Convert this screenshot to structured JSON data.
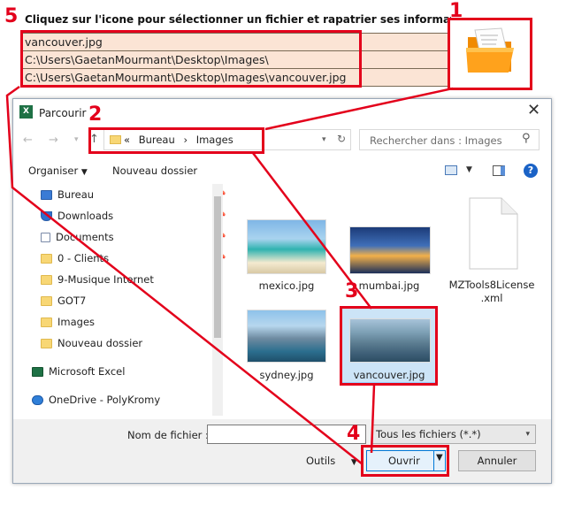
{
  "sheet": {
    "instruction": "Cliquez sur l'icone pour sélectionner un fichier et rapatrier ses informations",
    "rows": [
      "vancouver.jpg",
      "C:\\Users\\GaetanMourmant\\Desktop\\Images\\",
      "C:\\Users\\GaetanMourmant\\Desktop\\Images\\vancouver.jpg"
    ]
  },
  "annotations": {
    "n1": "1",
    "n2": "2",
    "n3": "3",
    "n4": "4",
    "n5": "5",
    "color": "#e3001b"
  },
  "dialog": {
    "title": "Parcourir",
    "app_icon": "X",
    "address": {
      "prefix": "«",
      "parts": [
        "Bureau",
        "Images"
      ],
      "separator": "›"
    },
    "search_placeholder": "Rechercher dans : Images",
    "toolbar": {
      "organize": "Organiser",
      "new_folder": "Nouveau dossier"
    },
    "nav_items": [
      {
        "label": "Bureau",
        "icon": "desktop-icon",
        "pinned": true
      },
      {
        "label": "Downloads",
        "icon": "download-icon",
        "pinned": true
      },
      {
        "label": "Documents",
        "icon": "document-icon",
        "pinned": true
      },
      {
        "label": "0 - Clients",
        "icon": "folder-icon",
        "pinned": true
      },
      {
        "label": "9-Musique Internet",
        "icon": "folder-icon",
        "pinned": false
      },
      {
        "label": "GOT7",
        "icon": "folder-icon",
        "pinned": false
      },
      {
        "label": "Images",
        "icon": "folder-icon",
        "pinned": false
      },
      {
        "label": "Nouveau dossier",
        "icon": "folder-icon",
        "pinned": false
      }
    ],
    "nav_roots": [
      "Microsoft Excel",
      "OneDrive - PolyKromy"
    ],
    "files": [
      {
        "name": "mexico.jpg"
      },
      {
        "name": "mumbai.jpg"
      },
      {
        "name": "MZTools8License.xml"
      },
      {
        "name": "sydney.jpg"
      },
      {
        "name": "vancouver.jpg"
      }
    ],
    "file_name_label": "Nom de fichier :",
    "file_name_value": "",
    "filter": "Tous les fichiers (*.*)",
    "tools": "Outils",
    "open": "Ouvrir",
    "cancel": "Annuler"
  }
}
